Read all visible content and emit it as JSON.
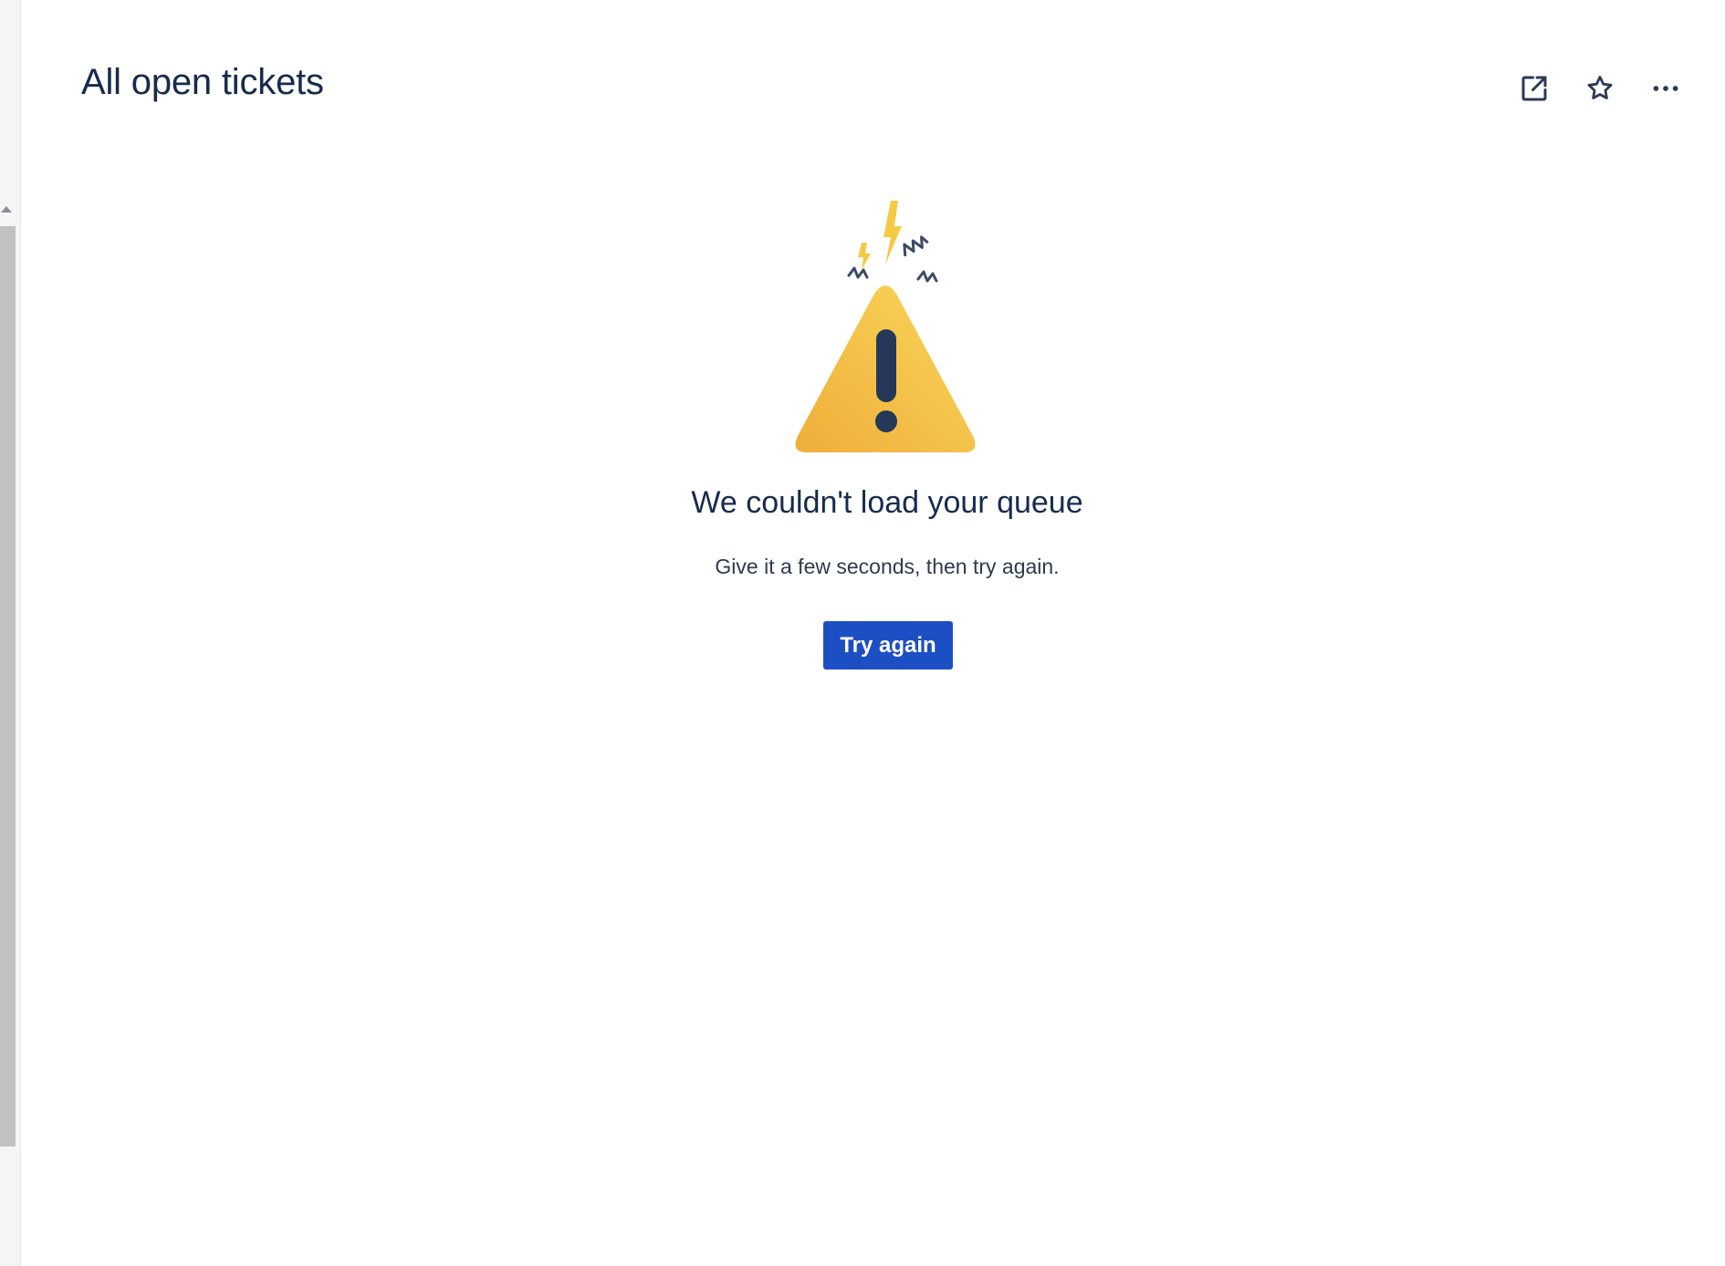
{
  "header": {
    "title": "All open tickets",
    "actions": [
      {
        "icon": "open-new-window-icon"
      },
      {
        "icon": "star-icon"
      },
      {
        "icon": "more-options-icon"
      }
    ]
  },
  "error": {
    "illustration": "warning-triangle-icon",
    "title": "We couldn't load your queue",
    "description": "Give it a few seconds, then try again.",
    "button_label": "Try again"
  },
  "colors": {
    "primary_button": "#1d4fc4",
    "warning_yellow": "#f6c944",
    "text_dark": "#172b4d"
  }
}
